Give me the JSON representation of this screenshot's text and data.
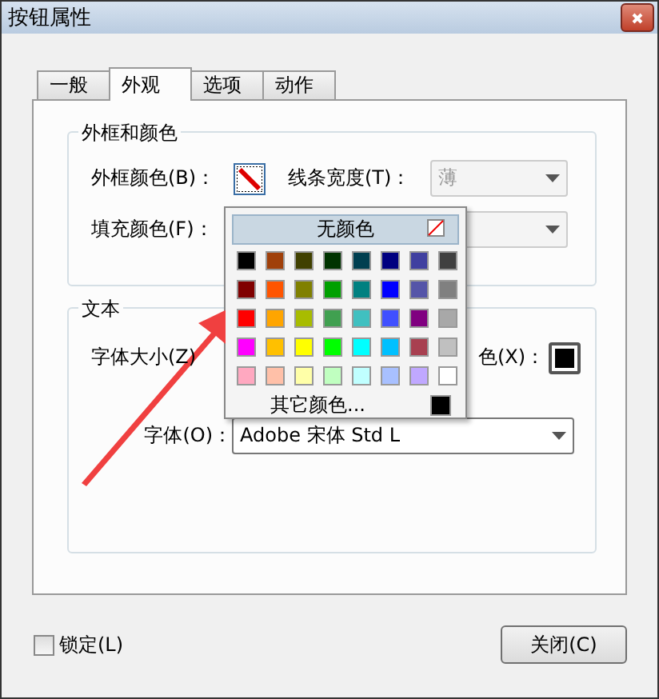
{
  "window": {
    "title": "按钮属性"
  },
  "tabs": [
    {
      "label": "一般",
      "selected": false
    },
    {
      "label": "外观",
      "selected": true
    },
    {
      "label": "选项",
      "selected": false
    },
    {
      "label": "动作",
      "selected": false
    }
  ],
  "border_group": {
    "title": "外框和颜色",
    "border_color_label": "外框颜色(B)：",
    "line_width_label": "线条宽度(T)：",
    "line_width_value": "薄",
    "line_width_disabled": true,
    "fill_color_label": "填充颜色(F)：",
    "fill_disabled": true
  },
  "color_popup": {
    "no_color_label": "无颜色",
    "swatches": [
      {
        "color": "#000000"
      },
      {
        "color": "#a0400a"
      },
      {
        "color": "#404000"
      },
      {
        "color": "#003300"
      },
      {
        "color": "#003f50"
      },
      {
        "color": "#000080"
      },
      {
        "color": "#4040a0"
      },
      {
        "color": "#404040"
      },
      {
        "color": "#800000"
      },
      {
        "color": "#ff5500"
      },
      {
        "color": "#808000"
      },
      {
        "color": "#00a000"
      },
      {
        "color": "#008080"
      },
      {
        "color": "#0000ff"
      },
      {
        "color": "#5555a8"
      },
      {
        "color": "#808080"
      },
      {
        "color": "#ff0000"
      },
      {
        "color": "#ffa500"
      },
      {
        "color": "#a8bc00"
      },
      {
        "color": "#40a050"
      },
      {
        "color": "#40c0c0"
      },
      {
        "color": "#4050ff"
      },
      {
        "color": "#800080"
      },
      {
        "color": "#a8a8a8"
      },
      {
        "color": "#ff00ff"
      },
      {
        "color": "#ffc000"
      },
      {
        "color": "#ffff00"
      },
      {
        "color": "#00ff00"
      },
      {
        "color": "#00ffff"
      },
      {
        "color": "#00c0ff"
      },
      {
        "color": "#a84050"
      },
      {
        "color": "#c0c0c0"
      },
      {
        "color": "#ffa8c0"
      },
      {
        "color": "#ffc0a8"
      },
      {
        "color": "#ffffa8"
      },
      {
        "color": "#c0ffc0"
      },
      {
        "color": "#c0ffff"
      },
      {
        "color": "#a8c0ff"
      },
      {
        "color": "#c0a8ff"
      },
      {
        "color": "#ffffff"
      }
    ],
    "more_colors_label": "其它颜色..."
  },
  "text_group": {
    "title": "文本",
    "font_size_label": "字体大小(Z)",
    "text_color_label": "色(X)：",
    "font_label": "字体(O)：",
    "font_value": "Adobe 宋体 Std L"
  },
  "locked": {
    "label": "锁定(L)",
    "checked": false
  },
  "close_button": "关闭(C)"
}
